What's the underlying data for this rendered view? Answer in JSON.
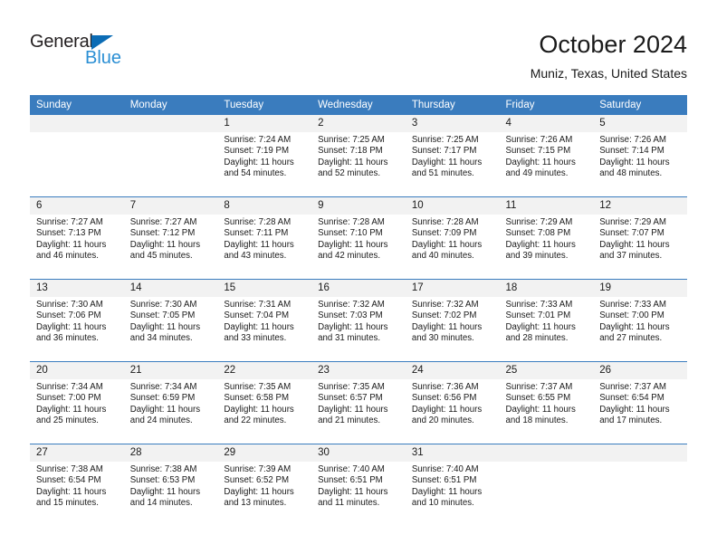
{
  "brand": {
    "name_primary": "General",
    "name_secondary": "Blue",
    "triangle_icon": "triangle-icon",
    "accent_color": "#2b8fd4"
  },
  "header": {
    "title": "October 2024",
    "subtitle": "Muniz, Texas, United States"
  },
  "calendar": {
    "header_bg": "#3a7cbe",
    "daynum_bg": "#f2f2f2",
    "weekdays": [
      "Sunday",
      "Monday",
      "Tuesday",
      "Wednesday",
      "Thursday",
      "Friday",
      "Saturday"
    ],
    "weeks": [
      [
        {
          "day": "",
          "sunrise": "",
          "sunset": "",
          "daylight": "",
          "empty": true
        },
        {
          "day": "",
          "sunrise": "",
          "sunset": "",
          "daylight": "",
          "empty": true
        },
        {
          "day": "1",
          "sunrise": "Sunrise: 7:24 AM",
          "sunset": "Sunset: 7:19 PM",
          "daylight": "Daylight: 11 hours and 54 minutes."
        },
        {
          "day": "2",
          "sunrise": "Sunrise: 7:25 AM",
          "sunset": "Sunset: 7:18 PM",
          "daylight": "Daylight: 11 hours and 52 minutes."
        },
        {
          "day": "3",
          "sunrise": "Sunrise: 7:25 AM",
          "sunset": "Sunset: 7:17 PM",
          "daylight": "Daylight: 11 hours and 51 minutes."
        },
        {
          "day": "4",
          "sunrise": "Sunrise: 7:26 AM",
          "sunset": "Sunset: 7:15 PM",
          "daylight": "Daylight: 11 hours and 49 minutes."
        },
        {
          "day": "5",
          "sunrise": "Sunrise: 7:26 AM",
          "sunset": "Sunset: 7:14 PM",
          "daylight": "Daylight: 11 hours and 48 minutes."
        }
      ],
      [
        {
          "day": "6",
          "sunrise": "Sunrise: 7:27 AM",
          "sunset": "Sunset: 7:13 PM",
          "daylight": "Daylight: 11 hours and 46 minutes."
        },
        {
          "day": "7",
          "sunrise": "Sunrise: 7:27 AM",
          "sunset": "Sunset: 7:12 PM",
          "daylight": "Daylight: 11 hours and 45 minutes."
        },
        {
          "day": "8",
          "sunrise": "Sunrise: 7:28 AM",
          "sunset": "Sunset: 7:11 PM",
          "daylight": "Daylight: 11 hours and 43 minutes."
        },
        {
          "day": "9",
          "sunrise": "Sunrise: 7:28 AM",
          "sunset": "Sunset: 7:10 PM",
          "daylight": "Daylight: 11 hours and 42 minutes."
        },
        {
          "day": "10",
          "sunrise": "Sunrise: 7:28 AM",
          "sunset": "Sunset: 7:09 PM",
          "daylight": "Daylight: 11 hours and 40 minutes."
        },
        {
          "day": "11",
          "sunrise": "Sunrise: 7:29 AM",
          "sunset": "Sunset: 7:08 PM",
          "daylight": "Daylight: 11 hours and 39 minutes."
        },
        {
          "day": "12",
          "sunrise": "Sunrise: 7:29 AM",
          "sunset": "Sunset: 7:07 PM",
          "daylight": "Daylight: 11 hours and 37 minutes."
        }
      ],
      [
        {
          "day": "13",
          "sunrise": "Sunrise: 7:30 AM",
          "sunset": "Sunset: 7:06 PM",
          "daylight": "Daylight: 11 hours and 36 minutes."
        },
        {
          "day": "14",
          "sunrise": "Sunrise: 7:30 AM",
          "sunset": "Sunset: 7:05 PM",
          "daylight": "Daylight: 11 hours and 34 minutes."
        },
        {
          "day": "15",
          "sunrise": "Sunrise: 7:31 AM",
          "sunset": "Sunset: 7:04 PM",
          "daylight": "Daylight: 11 hours and 33 minutes."
        },
        {
          "day": "16",
          "sunrise": "Sunrise: 7:32 AM",
          "sunset": "Sunset: 7:03 PM",
          "daylight": "Daylight: 11 hours and 31 minutes."
        },
        {
          "day": "17",
          "sunrise": "Sunrise: 7:32 AM",
          "sunset": "Sunset: 7:02 PM",
          "daylight": "Daylight: 11 hours and 30 minutes."
        },
        {
          "day": "18",
          "sunrise": "Sunrise: 7:33 AM",
          "sunset": "Sunset: 7:01 PM",
          "daylight": "Daylight: 11 hours and 28 minutes."
        },
        {
          "day": "19",
          "sunrise": "Sunrise: 7:33 AM",
          "sunset": "Sunset: 7:00 PM",
          "daylight": "Daylight: 11 hours and 27 minutes."
        }
      ],
      [
        {
          "day": "20",
          "sunrise": "Sunrise: 7:34 AM",
          "sunset": "Sunset: 7:00 PM",
          "daylight": "Daylight: 11 hours and 25 minutes."
        },
        {
          "day": "21",
          "sunrise": "Sunrise: 7:34 AM",
          "sunset": "Sunset: 6:59 PM",
          "daylight": "Daylight: 11 hours and 24 minutes."
        },
        {
          "day": "22",
          "sunrise": "Sunrise: 7:35 AM",
          "sunset": "Sunset: 6:58 PM",
          "daylight": "Daylight: 11 hours and 22 minutes."
        },
        {
          "day": "23",
          "sunrise": "Sunrise: 7:35 AM",
          "sunset": "Sunset: 6:57 PM",
          "daylight": "Daylight: 11 hours and 21 minutes."
        },
        {
          "day": "24",
          "sunrise": "Sunrise: 7:36 AM",
          "sunset": "Sunset: 6:56 PM",
          "daylight": "Daylight: 11 hours and 20 minutes."
        },
        {
          "day": "25",
          "sunrise": "Sunrise: 7:37 AM",
          "sunset": "Sunset: 6:55 PM",
          "daylight": "Daylight: 11 hours and 18 minutes."
        },
        {
          "day": "26",
          "sunrise": "Sunrise: 7:37 AM",
          "sunset": "Sunset: 6:54 PM",
          "daylight": "Daylight: 11 hours and 17 minutes."
        }
      ],
      [
        {
          "day": "27",
          "sunrise": "Sunrise: 7:38 AM",
          "sunset": "Sunset: 6:54 PM",
          "daylight": "Daylight: 11 hours and 15 minutes."
        },
        {
          "day": "28",
          "sunrise": "Sunrise: 7:38 AM",
          "sunset": "Sunset: 6:53 PM",
          "daylight": "Daylight: 11 hours and 14 minutes."
        },
        {
          "day": "29",
          "sunrise": "Sunrise: 7:39 AM",
          "sunset": "Sunset: 6:52 PM",
          "daylight": "Daylight: 11 hours and 13 minutes."
        },
        {
          "day": "30",
          "sunrise": "Sunrise: 7:40 AM",
          "sunset": "Sunset: 6:51 PM",
          "daylight": "Daylight: 11 hours and 11 minutes."
        },
        {
          "day": "31",
          "sunrise": "Sunrise: 7:40 AM",
          "sunset": "Sunset: 6:51 PM",
          "daylight": "Daylight: 11 hours and 10 minutes."
        },
        {
          "day": "",
          "sunrise": "",
          "sunset": "",
          "daylight": "",
          "empty": true
        },
        {
          "day": "",
          "sunrise": "",
          "sunset": "",
          "daylight": "",
          "empty": true
        }
      ]
    ]
  }
}
